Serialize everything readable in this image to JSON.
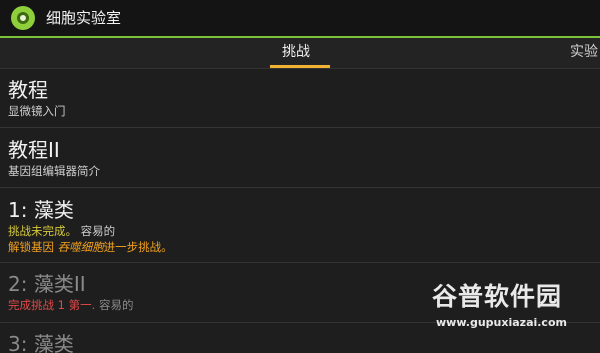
{
  "app": {
    "title": "细胞实验室",
    "logo_icon": "cell-icon"
  },
  "tabs": [
    {
      "label": "挑战",
      "selected": true
    },
    {
      "label": "实验",
      "selected": false
    }
  ],
  "items": [
    {
      "title": "教程",
      "subtitle": "显微镜入门"
    },
    {
      "title": "教程II",
      "subtitle": "基因组编辑器简介"
    },
    {
      "title": "1: 藻类",
      "status": "挑战未完成。",
      "difficulty": "容易的",
      "unlock_prefix": "解锁基因",
      "unlock_gene": "吞噬细胞",
      "unlock_suffix": "进一步挑战。"
    },
    {
      "title": "2: 藻类II",
      "requirement": "完成挑战 1 第一.",
      "difficulty": "容易的"
    },
    {
      "title": "3: 藻类"
    }
  ],
  "watermark": {
    "text": "谷普软件园",
    "url": "www.gupuxiazai.com"
  },
  "colors": {
    "accent_green": "#79c23a",
    "tab_indicator": "#f2b233",
    "status_yellow": "#d6c93c",
    "unlock_orange": "#f0a020",
    "requirement_red": "#e04848"
  }
}
